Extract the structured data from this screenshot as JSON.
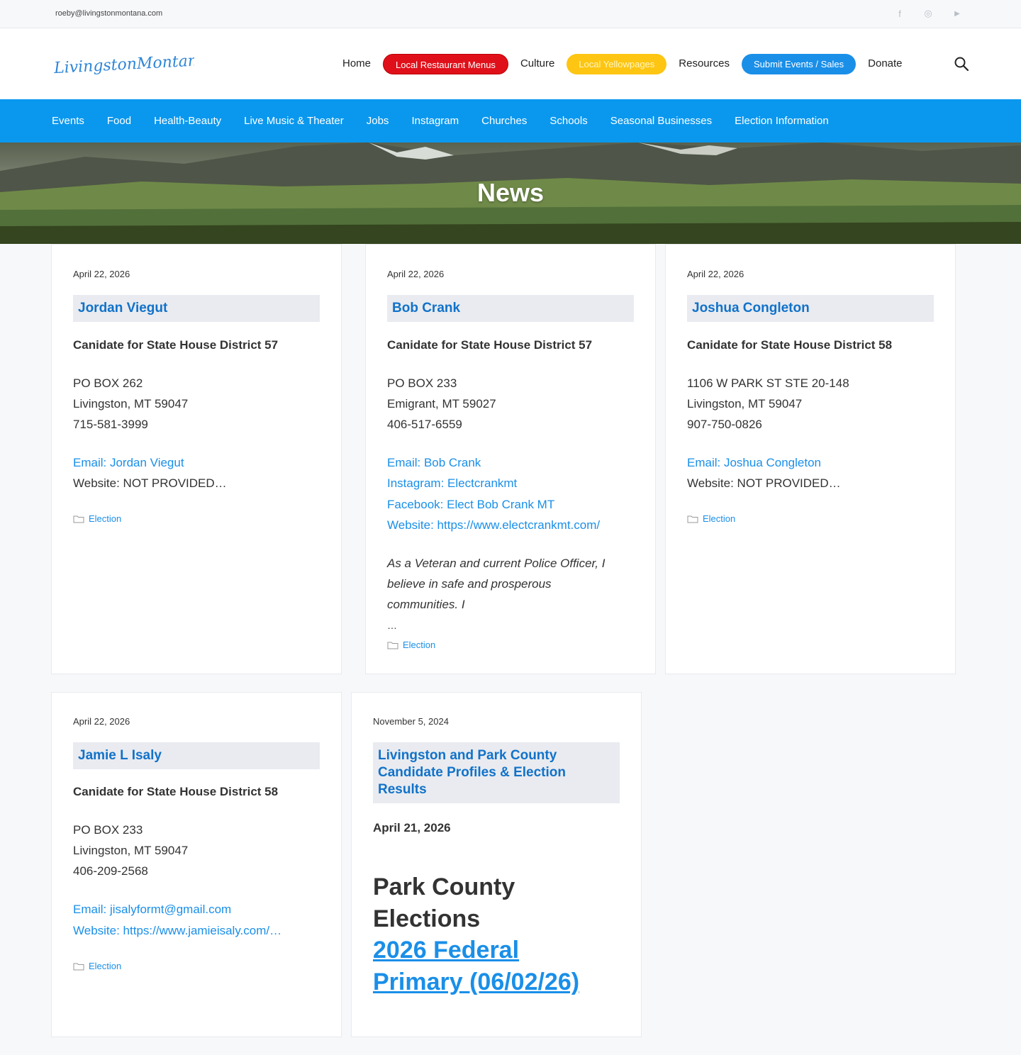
{
  "topbar": {
    "email": "roeby@livingstonmontana.com",
    "social": [
      {
        "icon": "facebook-icon",
        "glyph": "f"
      },
      {
        "icon": "instagram-icon",
        "glyph": "◎"
      },
      {
        "icon": "youtube-icon",
        "glyph": "▶"
      }
    ]
  },
  "header": {
    "logo_text": "LivingstonMontana.com",
    "nav": {
      "home": "Home",
      "restaurant": "Local Restaurant Menus",
      "culture": "Culture",
      "yellowpages": "Local Yellowpages",
      "resources": "Resources",
      "submit": "Submit Events / Sales",
      "donate": "Donate"
    },
    "colors": {
      "red": "#e0101a",
      "yellow": "#fec512",
      "blue": "#1a8fe8"
    }
  },
  "subnav": [
    "Events",
    "Food",
    "Health-Beauty",
    "Live Music & Theater",
    "Jobs",
    "Instagram",
    "Churches",
    "Schools",
    "Seasonal Businesses",
    "Election Information"
  ],
  "hero": {
    "title": "News"
  },
  "cards": {
    "c1": {
      "date": "April 22, 2026",
      "title": "Jordan Viegut",
      "subtitle": "Canidate for State House District 57",
      "address": [
        "PO BOX 262",
        "Livingston, MT 59047",
        "715-581-3999"
      ],
      "email": "Email: Jordan Viegut",
      "website": "Website: NOT PROVIDED…",
      "category": "Election"
    },
    "c2": {
      "date": "April 22, 2026",
      "title": "Bob Crank",
      "subtitle": "Canidate for State House District 57",
      "address": [
        "PO BOX 233",
        "Emigrant, MT 59027",
        "406-517-6559"
      ],
      "links": [
        "Email: Bob Crank",
        "Instagram: Electcrankmt",
        "Facebook: Elect Bob Crank MT",
        "Website: https://www.electcrankmt.com/"
      ],
      "excerpt": [
        "As a Veteran and current Police Officer, I",
        "believe in safe and prosperous",
        "communities. I"
      ],
      "ellipsis": "…",
      "category": "Election"
    },
    "c3": {
      "date": "April 22, 2026",
      "title": "Joshua Congleton",
      "subtitle": "Canidate for State House District 58",
      "address": [
        "1106 W PARK ST STE 20-148",
        "Livingston, MT 59047",
        "907-750-0826"
      ],
      "email": "Email: Joshua Congleton",
      "website": "Website: NOT PROVIDED…",
      "category": "Election"
    },
    "c4": {
      "date": "April 22, 2026",
      "title": "Jamie L Isaly",
      "subtitle": "Canidate for State House District 58",
      "address": [
        "PO BOX 233",
        "Livingston, MT 59047",
        "406-209-2568"
      ],
      "email": "Email: jisalyformt@gmail.com",
      "website": "Website: https://www.jamieisaly.com/…",
      "category": "Election"
    },
    "c5": {
      "date": "November 5, 2024",
      "title": [
        "Livingston and Park County",
        "Candidate Profiles & Election",
        "Results"
      ],
      "subtitle": "April 21, 2026",
      "heading": [
        "Park County",
        "Elections"
      ],
      "link": [
        "2026 Federal",
        "Primary (06/02/26)"
      ]
    }
  }
}
